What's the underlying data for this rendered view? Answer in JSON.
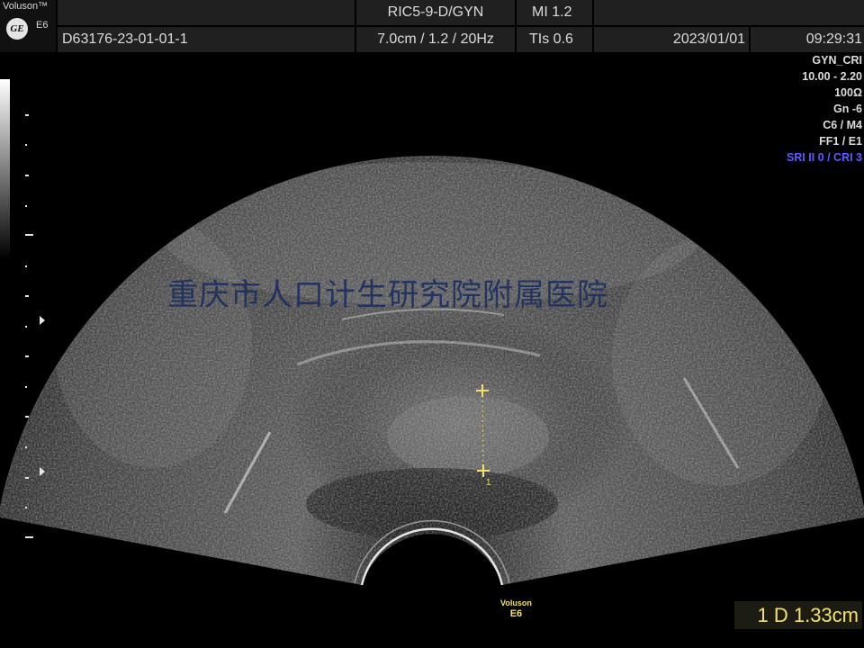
{
  "device": {
    "brand": "Voluson™",
    "model": "E6",
    "logo_text": "GE"
  },
  "header": {
    "probe": "RIC5-9-D/GYN",
    "mi": "MI  1.2",
    "patient_id": "D63176-23-01-01-1",
    "depth": "7.0cm / 1.2 / 20Hz",
    "tis": "TIs  0.6",
    "date": "2023/01/01",
    "time": "09:29:31"
  },
  "params": {
    "preset": "GYN_CRI",
    "frequency": "10.00 - 2.20",
    "power": "100",
    "power_icon": "ohm-icon",
    "gain": "Gn  -6",
    "cm": "C6 / M4",
    "ff": "FF1 / E1",
    "sri": "SRI II 0 / CRI 3"
  },
  "watermark": "重庆市人口计生研究院附属医院",
  "probe_label": {
    "brand": "Voluson",
    "model": "E6"
  },
  "measurement": {
    "label": "1 D 1.33cm",
    "caliper_index": "1",
    "value_cm": 1.33
  },
  "colors": {
    "header_cell": "#202020",
    "watermark": "#1d2f62",
    "caliper": "#f5e26a",
    "sri_text": "#5b5bff"
  }
}
